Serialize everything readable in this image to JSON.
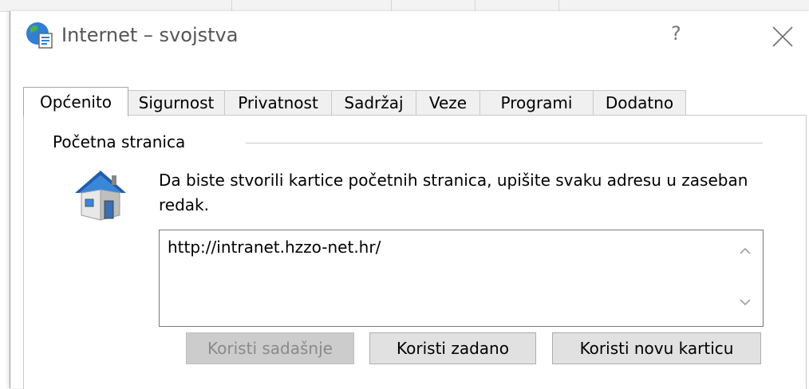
{
  "window": {
    "title": "Internet – svojstva",
    "help_label": "?",
    "app_icon": "internet-options-globe-icon",
    "close_icon": "close-icon"
  },
  "tabs": [
    {
      "label": "Općenito",
      "active": true
    },
    {
      "label": "Sigurnost",
      "active": false
    },
    {
      "label": "Privatnost",
      "active": false
    },
    {
      "label": "Sadržaj",
      "active": false
    },
    {
      "label": "Veze",
      "active": false
    },
    {
      "label": "Programi",
      "active": false
    },
    {
      "label": "Dodatno",
      "active": false
    }
  ],
  "home_page": {
    "group_label": "Početna stranica",
    "icon": "house-icon",
    "description": "Da biste stvorili kartice početnih stranica, upišite svaku adresu u zaseban redak.",
    "url_value": "http://intranet.hzzo-net.hr/",
    "buttons": {
      "use_current": "Koristi sadašnje",
      "use_default": "Koristi zadano",
      "use_new_tab": "Koristi novu karticu"
    }
  }
}
